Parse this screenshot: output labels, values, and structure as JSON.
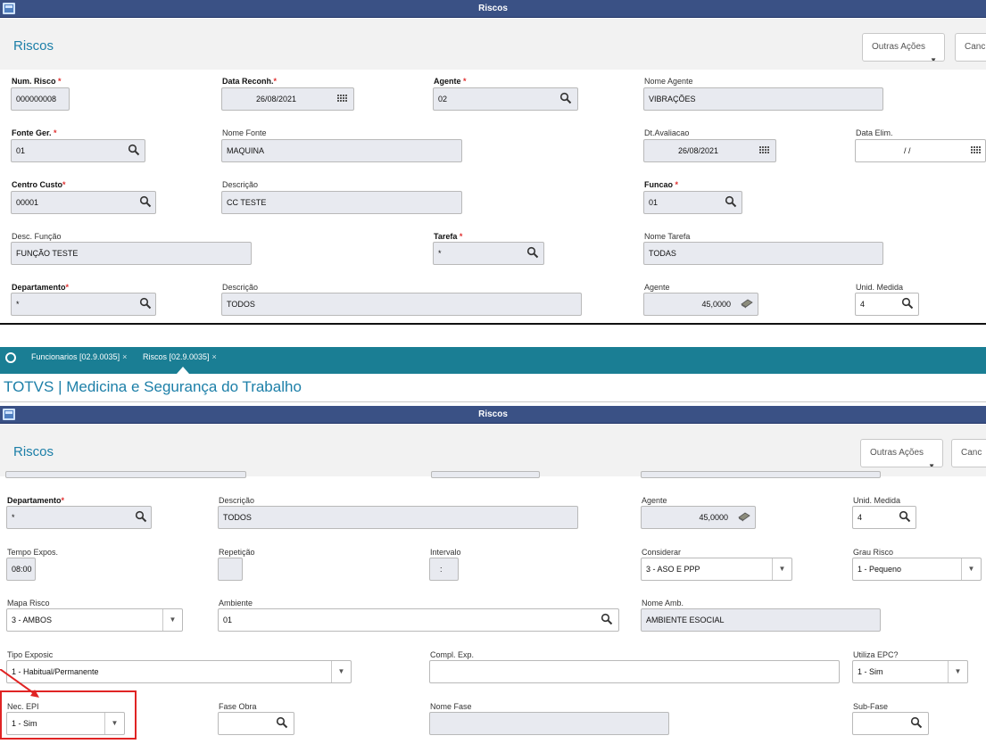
{
  "top": {
    "window_title": "Riscos",
    "page_title": "Riscos",
    "btn_more": "Outras Ações",
    "btn_cancel": "Canc",
    "fields": {
      "num_risco": {
        "label": "Num. Risco",
        "value": "000000008"
      },
      "data_reconh": {
        "label": "Data Reconh.",
        "value": "26/08/2021"
      },
      "agente": {
        "label": "Agente",
        "value": "02"
      },
      "nome_agente": {
        "label": "Nome Agente",
        "value": "VIBRAÇÕES"
      },
      "fonte_ger": {
        "label": "Fonte Ger.",
        "value": "01"
      },
      "nome_fonte": {
        "label": "Nome Fonte",
        "value": "MAQUINA"
      },
      "dt_avaliacao": {
        "label": "Dt.Avaliacao",
        "value": "26/08/2021"
      },
      "data_elim": {
        "label": "Data Elim.",
        "value": "/ /"
      },
      "centro_custo": {
        "label": "Centro Custo",
        "value": "00001"
      },
      "descricao_cc": {
        "label": "Descrição",
        "value": "CC TESTE"
      },
      "funcao": {
        "label": "Funcao",
        "value": "01"
      },
      "desc_funcao": {
        "label": "Desc. Função",
        "value": "FUNÇÃO TESTE"
      },
      "tarefa": {
        "label": "Tarefa",
        "value": "*"
      },
      "nome_tarefa": {
        "label": "Nome Tarefa",
        "value": "TODAS"
      },
      "departamento": {
        "label": "Departamento",
        "value": "*"
      },
      "descricao_dep": {
        "label": "Descrição",
        "value": "TODOS"
      },
      "agente_val": {
        "label": "Agente",
        "value": "45,0000"
      },
      "unid_medida": {
        "label": "Unid. Medida",
        "value": "4"
      }
    }
  },
  "tabs": [
    {
      "label": "Funcionarios [02.9.0035]",
      "close": "×"
    },
    {
      "label": "Riscos [02.9.0035]",
      "close": "×"
    }
  ],
  "app_title": "TOTVS | Medicina e Segurança do Trabalho",
  "bottom": {
    "window_title": "Riscos",
    "page_title": "Riscos",
    "btn_more": "Outras Ações",
    "btn_cancel": "Canc",
    "fields": {
      "departamento": {
        "label": "Departamento",
        "value": "*"
      },
      "descricao": {
        "label": "Descrição",
        "value": "TODOS"
      },
      "agente": {
        "label": "Agente",
        "value": "45,0000"
      },
      "unid_medida": {
        "label": "Unid. Medida",
        "value": "4"
      },
      "tempo_expos": {
        "label": "Tempo Expos.",
        "value": "08:00"
      },
      "repeticao": {
        "label": "Repetição",
        "value": ""
      },
      "intervalo": {
        "label": "Intervalo",
        "value": ":"
      },
      "considerar": {
        "label": "Considerar",
        "value": "3 - ASO E PPP"
      },
      "grau_risco": {
        "label": "Grau Risco",
        "value": "1 - Pequeno"
      },
      "mapa_risco": {
        "label": "Mapa Risco",
        "value": "3 - AMBOS"
      },
      "ambiente": {
        "label": "Ambiente",
        "value": "01"
      },
      "nome_amb": {
        "label": "Nome Amb.",
        "value": "AMBIENTE ESOCIAL"
      },
      "tipo_exposic": {
        "label": "Tipo Exposic",
        "value": "1 - Habitual/Permanente"
      },
      "compl_exp": {
        "label": "Compl. Exp.",
        "value": ""
      },
      "utiliza_epc": {
        "label": "Utiliza EPC?",
        "value": "1 - Sim"
      },
      "nec_epi": {
        "label": "Nec. EPI",
        "value": "1 - Sim"
      },
      "fase_obra": {
        "label": "Fase Obra",
        "value": ""
      },
      "nome_fase": {
        "label": "Nome Fase",
        "value": ""
      },
      "sub_fase": {
        "label": "Sub-Fase",
        "value": ""
      }
    }
  },
  "colors": {
    "titlebar": "#3a5185",
    "tabbar": "#1a7e94",
    "accent": "#1c7fa8",
    "required": "#e03030",
    "annotation": "#e02424"
  }
}
